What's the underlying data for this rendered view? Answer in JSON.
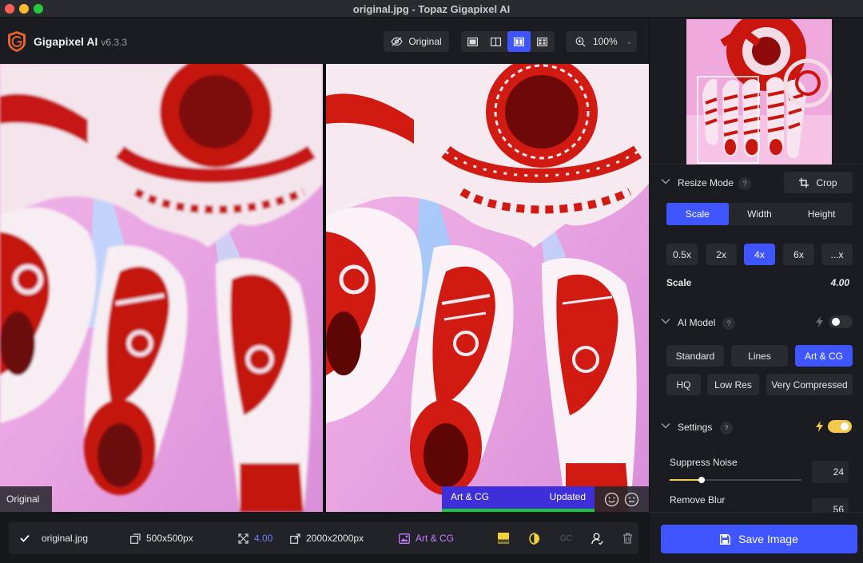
{
  "window": {
    "title": "original.jpg - Topaz Gigapixel AI"
  },
  "app": {
    "name": "Gigapixel AI",
    "version": "v6.3.3"
  },
  "toolbar": {
    "original_label": "Original",
    "zoom_value": "100%",
    "views": [
      "single-view",
      "split-view",
      "side-by-side-view",
      "grid-view"
    ],
    "active_view": "side-by-side-view"
  },
  "preview": {
    "left_label": "Original",
    "model_label": "Art & CG",
    "status_label": "Updated"
  },
  "bottom": {
    "filename": "original.jpg",
    "input_size": "500x500px",
    "scale": "4.00",
    "output_size": "2000x2000px",
    "model": "Art & CG",
    "gc_label": "GC"
  },
  "resize": {
    "title": "Resize Mode",
    "help": "?",
    "crop_label": "Crop",
    "modes": [
      "Scale",
      "Width",
      "Height"
    ],
    "active_mode": "Scale",
    "presets": [
      "0.5x",
      "2x",
      "4x",
      "6x",
      "...x"
    ],
    "active_preset": "4x",
    "scale_label": "Scale",
    "scale_value": "4.00"
  },
  "ai_model": {
    "title": "AI Model",
    "help": "?",
    "toggle_on": false,
    "models_row1": [
      "Standard",
      "Lines",
      "Art & CG"
    ],
    "models_row2": [
      "HQ",
      "Low Res",
      "Very Compressed"
    ],
    "active_model": "Art & CG"
  },
  "settings": {
    "title": "Settings",
    "help": "?",
    "toggle_on": true,
    "suppress_noise_label": "Suppress Noise",
    "suppress_noise_value": "24",
    "suppress_noise_fraction": 0.24,
    "remove_blur_label": "Remove Blur",
    "remove_blur_value": "56"
  },
  "save": {
    "label": "Save Image"
  },
  "colors": {
    "accent": "#3e55ff",
    "settings_toggle": "#f2c94c",
    "model_tag": "#3e2fd8",
    "status_bar": "#1cc53e"
  }
}
